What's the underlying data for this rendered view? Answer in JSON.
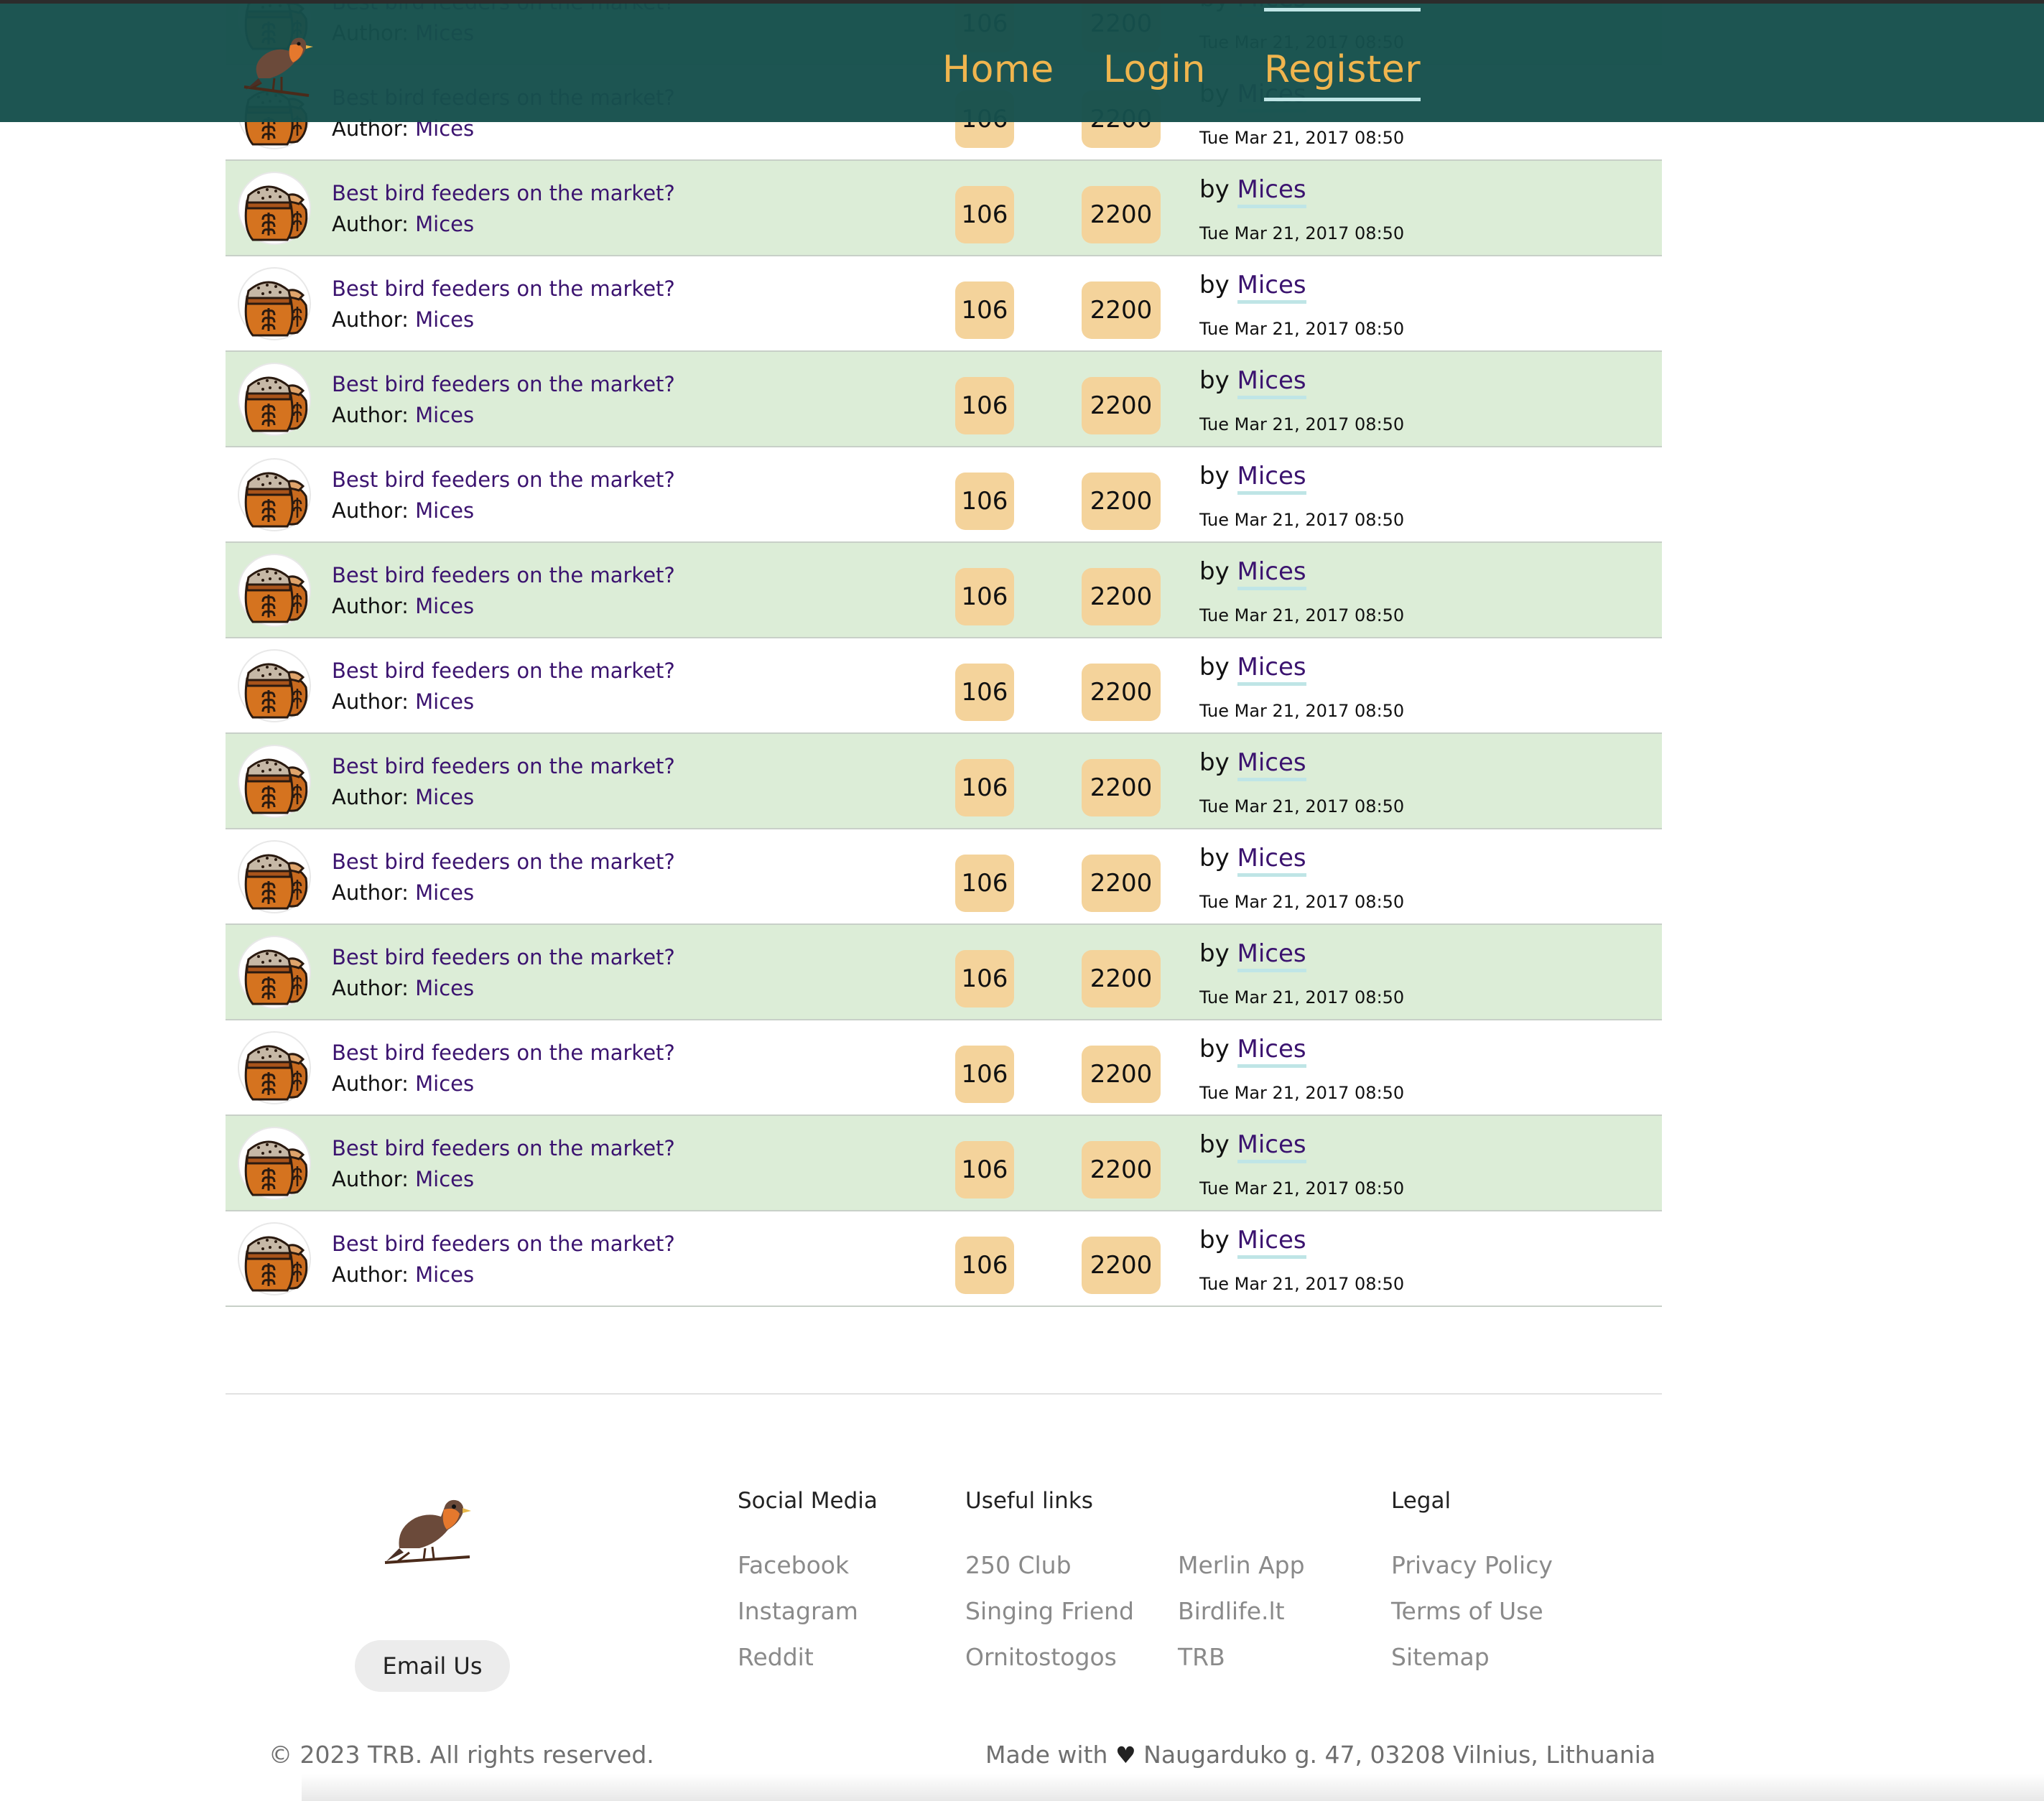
{
  "header": {
    "nav": [
      {
        "label": "Home",
        "active": false
      },
      {
        "label": "Login",
        "active": false
      },
      {
        "label": "Register",
        "active": true
      }
    ]
  },
  "topics": [
    {
      "title": "Best bird feeders on the market?",
      "author_label": "Author:",
      "author": "Mices",
      "replies": "106",
      "views": "2200",
      "by_label": "by",
      "last_user": "Mices",
      "date": "Tue Mar 21, 2017 08:50",
      "alt": true
    },
    {
      "title": "Best bird feeders on the market?",
      "author_label": "Author:",
      "author": "Mices",
      "replies": "106",
      "views": "2200",
      "by_label": "by",
      "last_user": "Mices",
      "date": "Tue Mar 21, 2017 08:50",
      "alt": false
    },
    {
      "title": "Best bird feeders on the market?",
      "author_label": "Author:",
      "author": "Mices",
      "replies": "106",
      "views": "2200",
      "by_label": "by",
      "last_user": "Mices",
      "date": "Tue Mar 21, 2017 08:50",
      "alt": true
    },
    {
      "title": "Best bird feeders on the market?",
      "author_label": "Author:",
      "author": "Mices",
      "replies": "106",
      "views": "2200",
      "by_label": "by",
      "last_user": "Mices",
      "date": "Tue Mar 21, 2017 08:50",
      "alt": false
    },
    {
      "title": "Best bird feeders on the market?",
      "author_label": "Author:",
      "author": "Mices",
      "replies": "106",
      "views": "2200",
      "by_label": "by",
      "last_user": "Mices",
      "date": "Tue Mar 21, 2017 08:50",
      "alt": true
    },
    {
      "title": "Best bird feeders on the market?",
      "author_label": "Author:",
      "author": "Mices",
      "replies": "106",
      "views": "2200",
      "by_label": "by",
      "last_user": "Mices",
      "date": "Tue Mar 21, 2017 08:50",
      "alt": false
    },
    {
      "title": "Best bird feeders on the market?",
      "author_label": "Author:",
      "author": "Mices",
      "replies": "106",
      "views": "2200",
      "by_label": "by",
      "last_user": "Mices",
      "date": "Tue Mar 21, 2017 08:50",
      "alt": true
    },
    {
      "title": "Best bird feeders on the market?",
      "author_label": "Author:",
      "author": "Mices",
      "replies": "106",
      "views": "2200",
      "by_label": "by",
      "last_user": "Mices",
      "date": "Tue Mar 21, 2017 08:50",
      "alt": false
    },
    {
      "title": "Best bird feeders on the market?",
      "author_label": "Author:",
      "author": "Mices",
      "replies": "106",
      "views": "2200",
      "by_label": "by",
      "last_user": "Mices",
      "date": "Tue Mar 21, 2017 08:50",
      "alt": true
    },
    {
      "title": "Best bird feeders on the market?",
      "author_label": "Author:",
      "author": "Mices",
      "replies": "106",
      "views": "2200",
      "by_label": "by",
      "last_user": "Mices",
      "date": "Tue Mar 21, 2017 08:50",
      "alt": false
    },
    {
      "title": "Best bird feeders on the market?",
      "author_label": "Author:",
      "author": "Mices",
      "replies": "106",
      "views": "2200",
      "by_label": "by",
      "last_user": "Mices",
      "date": "Tue Mar 21, 2017 08:50",
      "alt": true
    },
    {
      "title": "Best bird feeders on the market?",
      "author_label": "Author:",
      "author": "Mices",
      "replies": "106",
      "views": "2200",
      "by_label": "by",
      "last_user": "Mices",
      "date": "Tue Mar 21, 2017 08:50",
      "alt": false
    },
    {
      "title": "Best bird feeders on the market?",
      "author_label": "Author:",
      "author": "Mices",
      "replies": "106",
      "views": "2200",
      "by_label": "by",
      "last_user": "Mices",
      "date": "Tue Mar 21, 2017 08:50",
      "alt": true
    },
    {
      "title": "Best bird feeders on the market?",
      "author_label": "Author:",
      "author": "Mices",
      "replies": "106",
      "views": "2200",
      "by_label": "by",
      "last_user": "Mices",
      "date": "Tue Mar 21, 2017 08:50",
      "alt": false
    }
  ],
  "footer": {
    "email_button": "Email Us",
    "social": {
      "heading": "Social Media",
      "links": [
        "Facebook",
        "Instagram",
        "Reddit"
      ]
    },
    "useful": {
      "heading": "Useful links",
      "links_a": [
        "250 Club",
        "Singing Friend",
        "Ornitostogos"
      ],
      "links_b": [
        "Merlin App",
        "Birdlife.lt",
        "TRB"
      ]
    },
    "legal": {
      "heading": "Legal",
      "links": [
        "Privacy Policy",
        "Terms of Use",
        "Sitemap"
      ]
    },
    "copyright": "© 2023 TRB. All rights reserved.",
    "made_with": "Made with",
    "address": "Naugarduko g. 47, 03208 Vilnius, Lithuania"
  },
  "colors": {
    "header_bg": "#164f4c",
    "nav_text": "#f0b54e",
    "accent_underline": "#bfe5e6",
    "row_alt_bg": "#dcedd7",
    "badge_bg": "#f4d39b",
    "link_purple": "#3b136f"
  },
  "icons": {
    "brand": "robin-bird-icon",
    "topic": "seed-sack-icon",
    "heart": "heart-icon"
  }
}
